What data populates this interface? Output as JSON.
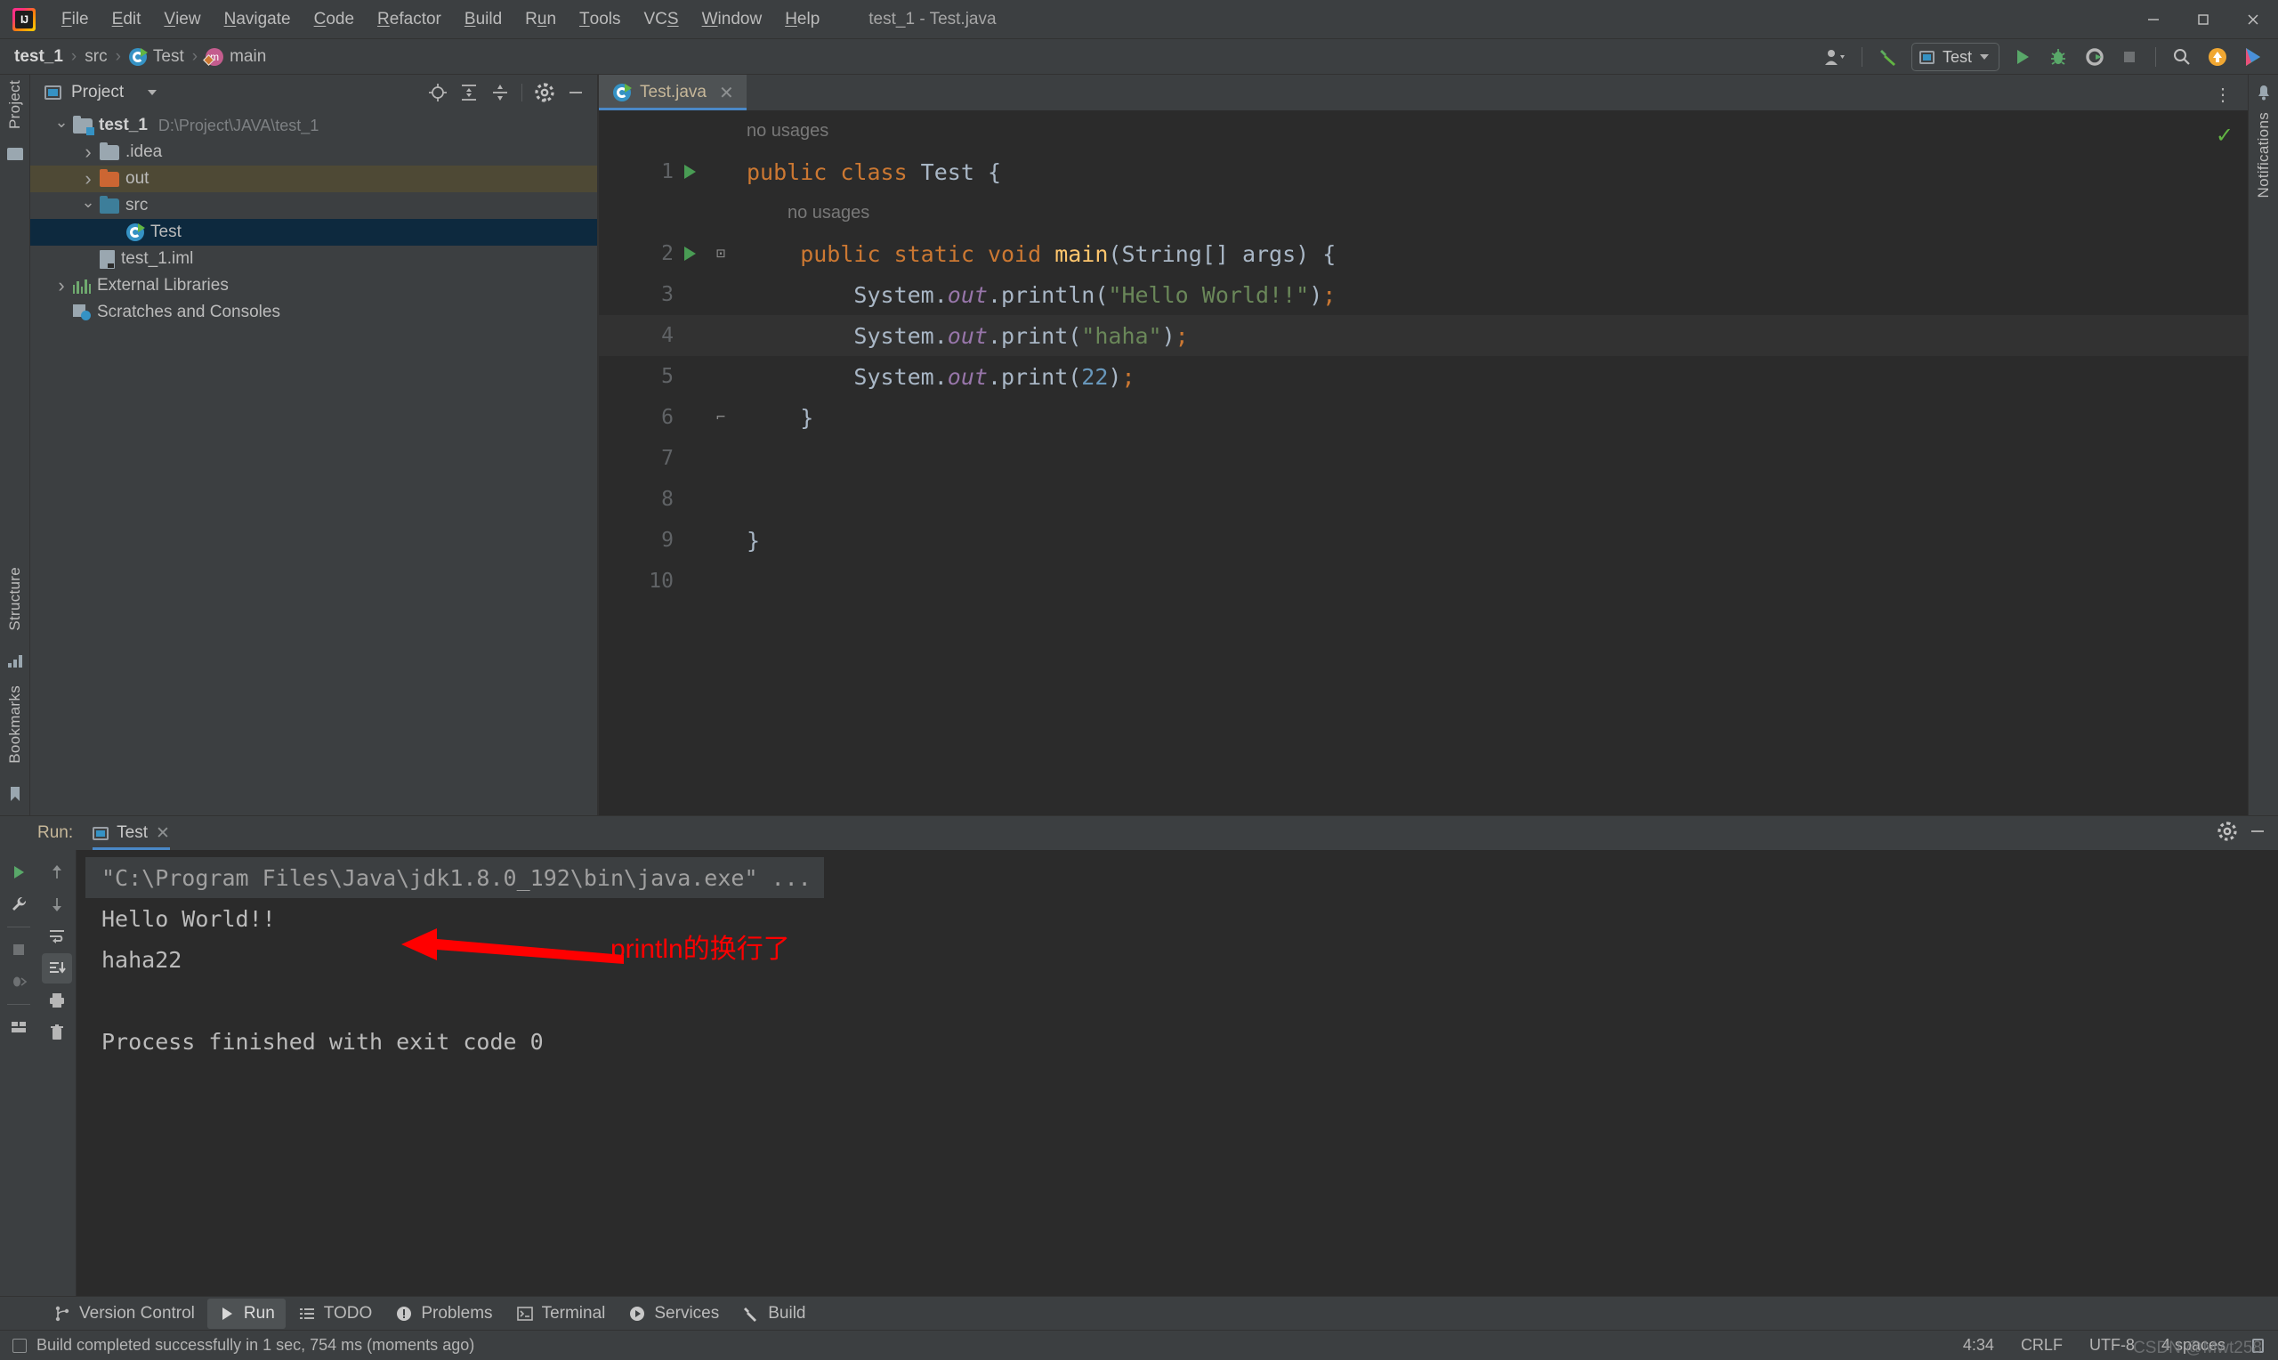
{
  "titlebar": {
    "logo": "intellij-logo",
    "menus": [
      {
        "label": "File",
        "mnemonic": "F"
      },
      {
        "label": "Edit",
        "mnemonic": "E"
      },
      {
        "label": "View",
        "mnemonic": "V"
      },
      {
        "label": "Navigate",
        "mnemonic": "N"
      },
      {
        "label": "Code",
        "mnemonic": "C"
      },
      {
        "label": "Refactor",
        "mnemonic": "R"
      },
      {
        "label": "Build",
        "mnemonic": "B"
      },
      {
        "label": "Run",
        "mnemonic": "u"
      },
      {
        "label": "Tools",
        "mnemonic": "T"
      },
      {
        "label": "VCS",
        "mnemonic": "S"
      },
      {
        "label": "Window",
        "mnemonic": "W"
      },
      {
        "label": "Help",
        "mnemonic": "H"
      }
    ],
    "title": "test_1 - Test.java",
    "window_buttons": {
      "minimize": "–",
      "maximize": "❐",
      "close": "✕"
    }
  },
  "navbar": {
    "breadcrumbs": [
      {
        "label": "test_1",
        "icon": "none",
        "bold": true
      },
      {
        "label": "src",
        "icon": "none",
        "bold": false
      },
      {
        "label": "Test",
        "icon": "class-icon",
        "bold": false
      },
      {
        "label": "main",
        "icon": "method-icon",
        "bold": false
      }
    ],
    "separator": "›",
    "toolbar": {
      "account": "account-icon",
      "build": "build-hammer-icon",
      "run_config": "Test",
      "run": "run-icon",
      "debug": "debug-icon",
      "coverage": "run-with-coverage-icon",
      "stop": "stop-icon",
      "search": "search-icon",
      "update": "update-icon",
      "ide": "ide-icon"
    }
  },
  "left_rail": {
    "label": "Project",
    "bottom_labels": [
      "Structure",
      "Bookmarks"
    ]
  },
  "right_rail": {
    "label": "Notifications"
  },
  "project_panel": {
    "title": "Project",
    "tools": [
      "locate-icon",
      "expand-all-icon",
      "collapse-all-icon",
      "settings-gear-icon",
      "hide-icon"
    ],
    "tree": [
      {
        "label": "test_1",
        "detail": "D:\\Project\\JAVA\\test_1",
        "icon": "module-folder",
        "twist": "down",
        "indent": 0,
        "bold": true,
        "state": "normal"
      },
      {
        "label": ".idea",
        "detail": "",
        "icon": "folder-gray",
        "twist": "right",
        "indent": 1,
        "bold": false,
        "state": "normal"
      },
      {
        "label": "out",
        "detail": "",
        "icon": "folder-orange",
        "twist": "right",
        "indent": 1,
        "bold": false,
        "state": "highlight"
      },
      {
        "label": "src",
        "detail": "",
        "icon": "folder-blue",
        "twist": "down",
        "indent": 1,
        "bold": false,
        "state": "normal"
      },
      {
        "label": "Test",
        "detail": "",
        "icon": "class-icon",
        "twist": "none",
        "indent": 2,
        "bold": false,
        "state": "selected"
      },
      {
        "label": "test_1.iml",
        "detail": "",
        "icon": "iml-icon",
        "twist": "none",
        "indent": 1,
        "bold": false,
        "state": "normal"
      },
      {
        "label": "External Libraries",
        "detail": "",
        "icon": "library-icon",
        "twist": "right",
        "indent": 0,
        "bold": false,
        "state": "normal"
      },
      {
        "label": "Scratches and Consoles",
        "detail": "",
        "icon": "scratch-icon",
        "twist": "none",
        "indent": 0,
        "bold": false,
        "state": "normal"
      }
    ]
  },
  "editor": {
    "tab": {
      "label": "Test.java",
      "icon": "class-icon",
      "close": "✕"
    },
    "options_icon": "⋮",
    "inspection_status": "✓",
    "lines": [
      {
        "num": "",
        "hint": "no usages",
        "hint_indent": 0,
        "caret": false,
        "gutter_run": false,
        "fold": "",
        "tokens": []
      },
      {
        "num": "1",
        "hint": "",
        "caret": false,
        "gutter_run": true,
        "fold": "",
        "tokens": [
          {
            "t": "public ",
            "c": "kw"
          },
          {
            "t": "class ",
            "c": "kw"
          },
          {
            "t": "Test",
            "c": "cls"
          },
          {
            "t": " {",
            "c": "punc"
          }
        ]
      },
      {
        "num": "",
        "hint": "no usages",
        "hint_indent": 1,
        "caret": false,
        "gutter_run": false,
        "fold": "",
        "tokens": []
      },
      {
        "num": "2",
        "hint": "",
        "caret": false,
        "gutter_run": true,
        "fold": "⊡",
        "tokens": [
          {
            "t": "    public ",
            "c": "kw"
          },
          {
            "t": "static ",
            "c": "kw"
          },
          {
            "t": "void ",
            "c": "kw"
          },
          {
            "t": "main",
            "c": "mth"
          },
          {
            "t": "(",
            "c": "punc"
          },
          {
            "t": "String",
            "c": "cls"
          },
          {
            "t": "[] args) {",
            "c": "punc"
          }
        ]
      },
      {
        "num": "3",
        "hint": "",
        "caret": false,
        "gutter_run": false,
        "fold": "",
        "tokens": [
          {
            "t": "        System",
            "c": "cls"
          },
          {
            "t": ".",
            "c": "punc"
          },
          {
            "t": "out",
            "c": "fld"
          },
          {
            "t": ".println(",
            "c": "punc"
          },
          {
            "t": "\"Hello World!!\"",
            "c": "str"
          },
          {
            "t": ")",
            "c": "punc"
          },
          {
            "t": ";",
            "c": "semi"
          }
        ]
      },
      {
        "num": "4",
        "hint": "",
        "caret": true,
        "gutter_run": false,
        "fold": "",
        "tokens": [
          {
            "t": "        System",
            "c": "cls"
          },
          {
            "t": ".",
            "c": "punc"
          },
          {
            "t": "out",
            "c": "fld"
          },
          {
            "t": ".print(",
            "c": "punc"
          },
          {
            "t": "\"haha\"",
            "c": "str"
          },
          {
            "t": ")",
            "c": "punc"
          },
          {
            "t": ";",
            "c": "semi"
          }
        ]
      },
      {
        "num": "5",
        "hint": "",
        "caret": false,
        "gutter_run": false,
        "fold": "",
        "tokens": [
          {
            "t": "        System",
            "c": "cls"
          },
          {
            "t": ".",
            "c": "punc"
          },
          {
            "t": "out",
            "c": "fld"
          },
          {
            "t": ".print(",
            "c": "punc"
          },
          {
            "t": "22",
            "c": "num"
          },
          {
            "t": ")",
            "c": "punc"
          },
          {
            "t": ";",
            "c": "semi"
          }
        ]
      },
      {
        "num": "6",
        "hint": "",
        "caret": false,
        "gutter_run": false,
        "fold": "⌐",
        "tokens": [
          {
            "t": "    }",
            "c": "punc"
          }
        ]
      },
      {
        "num": "7",
        "hint": "",
        "caret": false,
        "gutter_run": false,
        "fold": "",
        "tokens": []
      },
      {
        "num": "8",
        "hint": "",
        "caret": false,
        "gutter_run": false,
        "fold": "",
        "tokens": []
      },
      {
        "num": "9",
        "hint": "",
        "caret": false,
        "gutter_run": false,
        "fold": "",
        "tokens": [
          {
            "t": "}",
            "c": "punc"
          }
        ]
      },
      {
        "num": "10",
        "hint": "",
        "caret": false,
        "gutter_run": false,
        "fold": "",
        "tokens": []
      }
    ]
  },
  "run_panel": {
    "label": "Run:",
    "tab": "Test",
    "tab_close": "✕",
    "header_tools": [
      "settings-gear-icon",
      "hide-icon"
    ],
    "left_tools": [
      "rerun-icon",
      "wrench-icon",
      "stop-icon",
      "rerun-failed-icon",
      "layout-icon"
    ],
    "right_tools": [
      "up-arrow-icon",
      "down-arrow-icon",
      "soft-wrap-icon",
      "scroll-to-end-icon",
      "print-icon",
      "trash-icon"
    ],
    "console": [
      {
        "text": "\"C:\\Program Files\\Java\\jdk1.8.0_192\\bin\\java.exe\" ...",
        "style": "command"
      },
      {
        "text": "Hello World!!",
        "style": "output"
      },
      {
        "text": "haha22",
        "style": "output"
      },
      {
        "text": "",
        "style": "output"
      },
      {
        "text": "Process finished with exit code 0",
        "style": "output"
      }
    ],
    "annotation": {
      "text": "println的换行了",
      "color": "#ff0000",
      "arrow": "left-arrow"
    }
  },
  "bottom_bar": {
    "items": [
      {
        "label": "Version Control",
        "icon": "branch-icon",
        "active": false
      },
      {
        "label": "Run",
        "icon": "run-icon",
        "active": true
      },
      {
        "label": "TODO",
        "icon": "todo-list-icon",
        "active": false
      },
      {
        "label": "Problems",
        "icon": "problems-icon",
        "active": false
      },
      {
        "label": "Terminal",
        "icon": "terminal-icon",
        "active": false
      },
      {
        "label": "Services",
        "icon": "services-icon",
        "active": false
      },
      {
        "label": "Build",
        "icon": "build-hammer-icon",
        "active": false
      }
    ]
  },
  "status_bar": {
    "message": "Build completed successfully in 1 sec, 754 ms (moments ago)",
    "caret_position": "4:34",
    "line_separator": "CRLF",
    "encoding": "UTF-8",
    "indent": "4 spaces",
    "watermark": "CSDN @Mwt258"
  },
  "colors": {
    "background": "#3c3f41",
    "editor_bg": "#2b2b2b",
    "accent_blue": "#4a88c7",
    "selection": "#0d293e",
    "highlight": "#4e4935",
    "keyword": "#cc7832",
    "string": "#6a8759",
    "number": "#6897bb",
    "field": "#9876aa",
    "method": "#ffc66d",
    "annotation_red": "#ff0000"
  }
}
